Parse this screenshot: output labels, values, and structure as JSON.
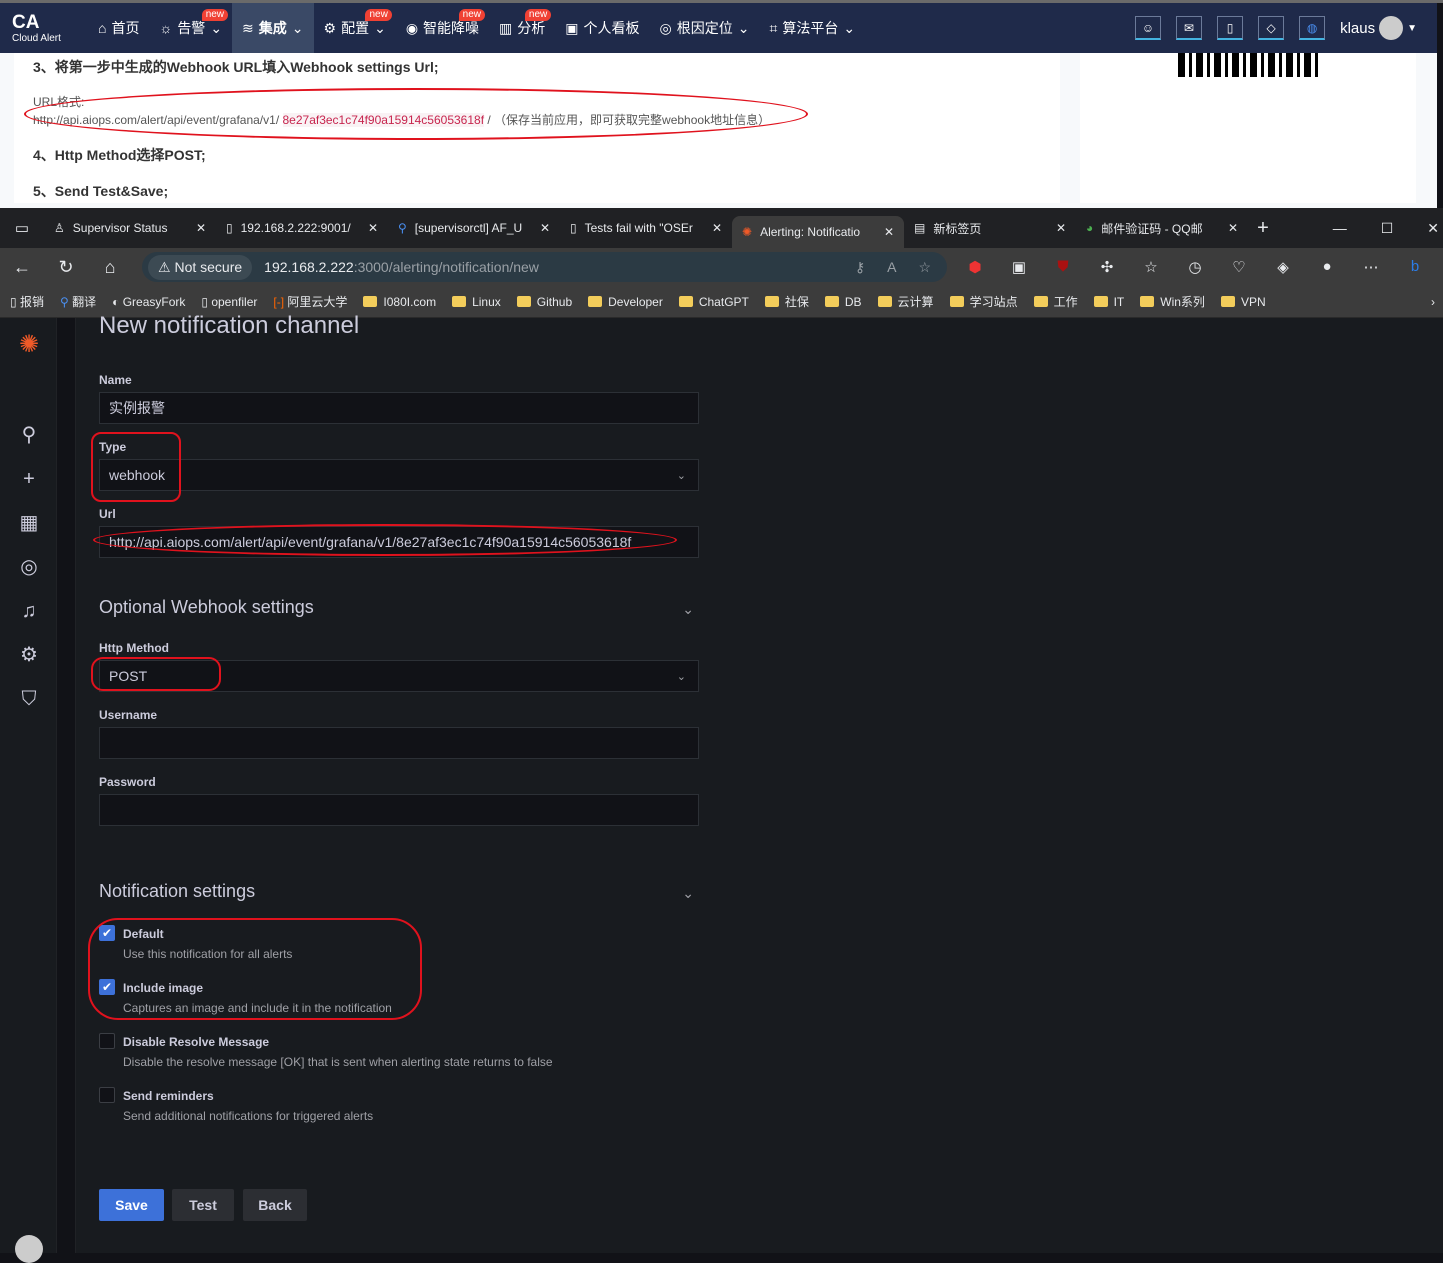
{
  "cloud_alert": {
    "logo": "CA",
    "logo_sub": "Cloud Alert",
    "nav": [
      {
        "label": "首页",
        "icon": "home-icon"
      },
      {
        "label": "告警",
        "badge": "new",
        "caret": true
      },
      {
        "label": "集成",
        "active": true,
        "caret": true
      },
      {
        "label": "配置",
        "badge": "new",
        "caret": true
      },
      {
        "label": "智能降噪",
        "badge": "new"
      },
      {
        "label": "分析",
        "badge": "new"
      },
      {
        "label": "个人看板"
      },
      {
        "label": "根因定位",
        "caret": true
      },
      {
        "label": "算法平台",
        "caret": true
      }
    ],
    "user": "klaus",
    "doc": {
      "step3": "3、将第一步中生成的Webhook URL填入Webhook settings Url;",
      "url_format_label": "URL格式:",
      "url_prefix": "http://api.aiops.com/alert/api/event/grafana/v1/",
      "url_key": "8e27af3ec1c74f90a15914c56053618f",
      "url_suffix": "/ （保存当前应用，即可获取完整webhook地址信息）",
      "step4": "4、Http Method选择POST;",
      "step5": "5、Send Test&Save;"
    }
  },
  "browser": {
    "tabs": [
      {
        "title": "Supervisor Status"
      },
      {
        "title": "192.168.2.222:9001/"
      },
      {
        "title": "[supervisorctl] AF_U"
      },
      {
        "title": "Tests fail with \"OSEr"
      },
      {
        "title": "Alerting: Notificatio",
        "active": true
      },
      {
        "title": "新标签页"
      },
      {
        "title": "邮件验证码 - QQ邮"
      }
    ],
    "not_secure": "Not secure",
    "url_host": "192.168.2.222",
    "url_rest": ":3000/alerting/notification/new",
    "bookmarks": [
      "报销",
      "翻译",
      "GreasyFork",
      "openfiler",
      "阿里云大学",
      "I080I.com",
      "Linux",
      "Github",
      "Developer",
      "ChatGPT",
      "社保",
      "DB",
      "云计算",
      "学习站点",
      "工作",
      "IT",
      "Win系列",
      "VPN"
    ]
  },
  "grafana": {
    "page_title": "New notification channel",
    "name_label": "Name",
    "name_value": "实例报警",
    "type_label": "Type",
    "type_value": "webhook",
    "url_label": "Url",
    "url_value": "http://api.aiops.com/alert/api/event/grafana/v1/8e27af3ec1c74f90a15914c56053618f",
    "optional_section": "Optional Webhook settings",
    "method_label": "Http Method",
    "method_value": "POST",
    "username_label": "Username",
    "username_value": "",
    "password_label": "Password",
    "password_value": "",
    "notif_section": "Notification settings",
    "options": [
      {
        "label": "Default",
        "desc": "Use this notification for all alerts",
        "checked": true
      },
      {
        "label": "Include image",
        "desc": "Captures an image and include it in the notification",
        "checked": true
      },
      {
        "label": "Disable Resolve Message",
        "desc": "Disable the resolve message [OK] that is sent when alerting state returns to false",
        "checked": false
      },
      {
        "label": "Send reminders",
        "desc": "Send additional notifications for triggered alerts",
        "checked": false
      }
    ],
    "save": "Save",
    "test": "Test",
    "back": "Back"
  },
  "colors": {
    "primary": "#3d71d9",
    "annotation": "#e0121d",
    "nav": "#1f2a4a"
  }
}
